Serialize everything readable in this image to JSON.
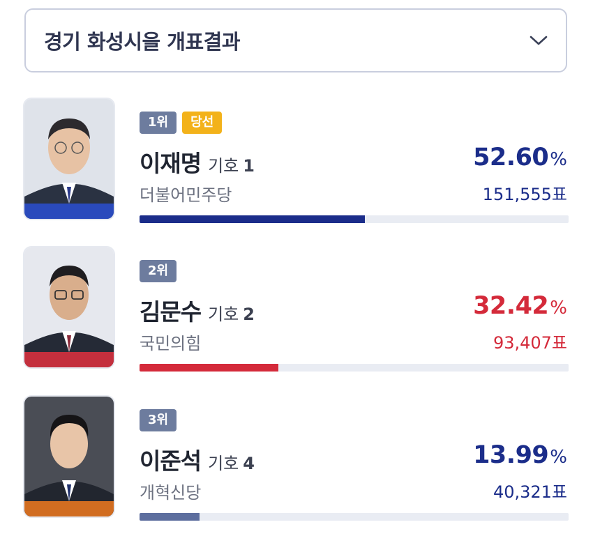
{
  "dropdown": {
    "label": "경기 화성시을 개표결과",
    "icon": "chevron-down-icon"
  },
  "candidates": [
    {
      "rank": "1위",
      "elected": "당선",
      "name": "이재명",
      "symbol_label": "기호",
      "symbol_number": "1",
      "party": "더불어민주당",
      "percent": "52.60",
      "percent_unit": "%",
      "votes": "151,555표",
      "vote_share": 0.526,
      "color": "#1b2d8a",
      "photo_stripe": "#2a4fd1"
    },
    {
      "rank": "2위",
      "name": "김문수",
      "symbol_label": "기호",
      "symbol_number": "2",
      "party": "국민의힘",
      "percent": "32.42",
      "percent_unit": "%",
      "votes": "93,407표",
      "vote_share": 0.3242,
      "color": "#d42a3a",
      "photo_stripe": "#e0303e"
    },
    {
      "rank": "3위",
      "name": "이준석",
      "symbol_label": "기호",
      "symbol_number": "4",
      "party": "개혁신당",
      "percent": "13.99",
      "percent_unit": "%",
      "votes": "40,321표",
      "vote_share": 0.1399,
      "color": "#1b2d8a",
      "bar_color": "#5d6e9e",
      "photo_stripe": "#f07a1e"
    }
  ]
}
